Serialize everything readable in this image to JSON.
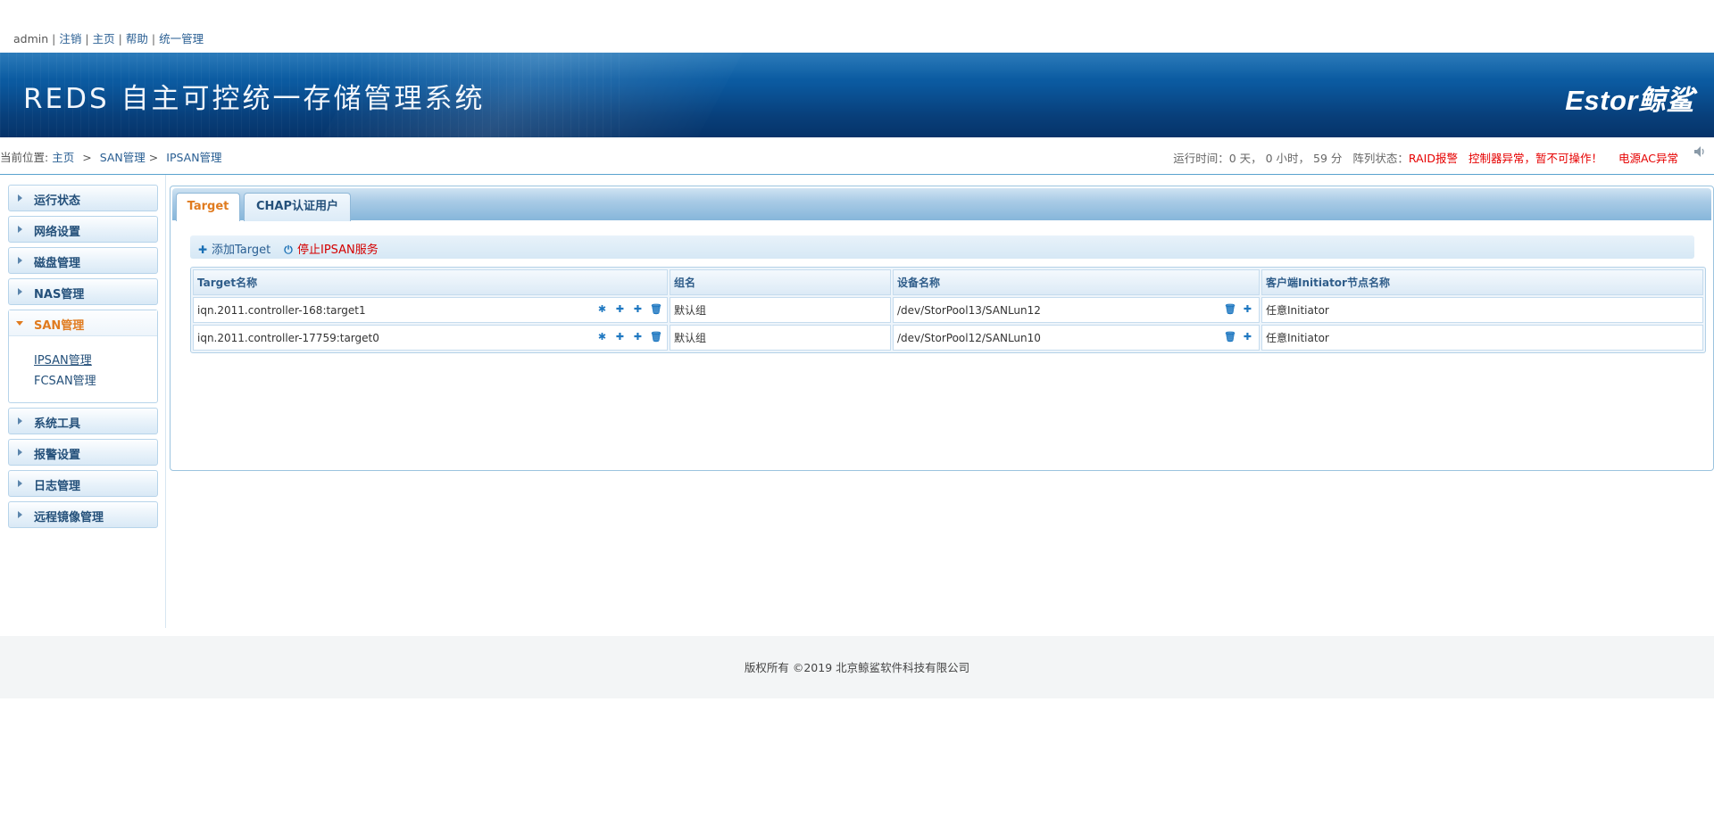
{
  "top_links": {
    "user": "admin",
    "logout": "注销",
    "home": "主页",
    "help": "帮助",
    "unified": "统一管理"
  },
  "banner": {
    "title": "REDS 自主可控统一存储管理系统",
    "logo": "Estor鲸鲨"
  },
  "breadcrumb": {
    "prefix": "当前位置:",
    "home": "主页",
    "san": "SAN管理",
    "ipsan": "IPSAN管理"
  },
  "status": {
    "runtime_label": "运行时间：0 天， 0 小时， 59 分",
    "array_label": "阵列状态：",
    "raid_alarm": "RAID报警",
    "controller_alarm": "控制器异常，暂不可操作！",
    "power_alarm": "电源AC异常"
  },
  "sidebar": {
    "items": [
      {
        "label": "运行状态"
      },
      {
        "label": "网络设置"
      },
      {
        "label": "磁盘管理"
      },
      {
        "label": "NAS管理"
      }
    ],
    "open": {
      "label": "SAN管理",
      "children": [
        {
          "label": "IPSAN管理"
        },
        {
          "label": "FCSAN管理"
        }
      ]
    },
    "items_after": [
      {
        "label": "系统工具"
      },
      {
        "label": "报警设置"
      },
      {
        "label": "日志管理"
      },
      {
        "label": "远程镜像管理"
      }
    ]
  },
  "tabs": [
    {
      "label": "Target"
    },
    {
      "label": "CHAP认证用户"
    }
  ],
  "toolbar": {
    "add_label": "添加Target",
    "stop_label": "停止IPSAN服务"
  },
  "table": {
    "headers": [
      "Target名称",
      "组名",
      "设备名称",
      "客户端Initiator节点名称"
    ],
    "rows": [
      {
        "target": "iqn.2011.controller-168:target1",
        "group": "默认组",
        "device": "/dev/StorPool13/SANLun12",
        "initiator": "任意Initiator"
      },
      {
        "target": "iqn.2011.controller-17759:target0",
        "group": "默认组",
        "device": "/dev/StorPool12/SANLun10",
        "initiator": "任意Initiator"
      }
    ]
  },
  "footer": {
    "copyright": "版权所有 ©2019 北京鲸鲨软件科技有限公司"
  },
  "colors": {
    "banner": "#0b5aa0",
    "accent_orange": "#e07b1f",
    "alarm_red": "#e60000",
    "link_blue": "#2a5f93"
  }
}
